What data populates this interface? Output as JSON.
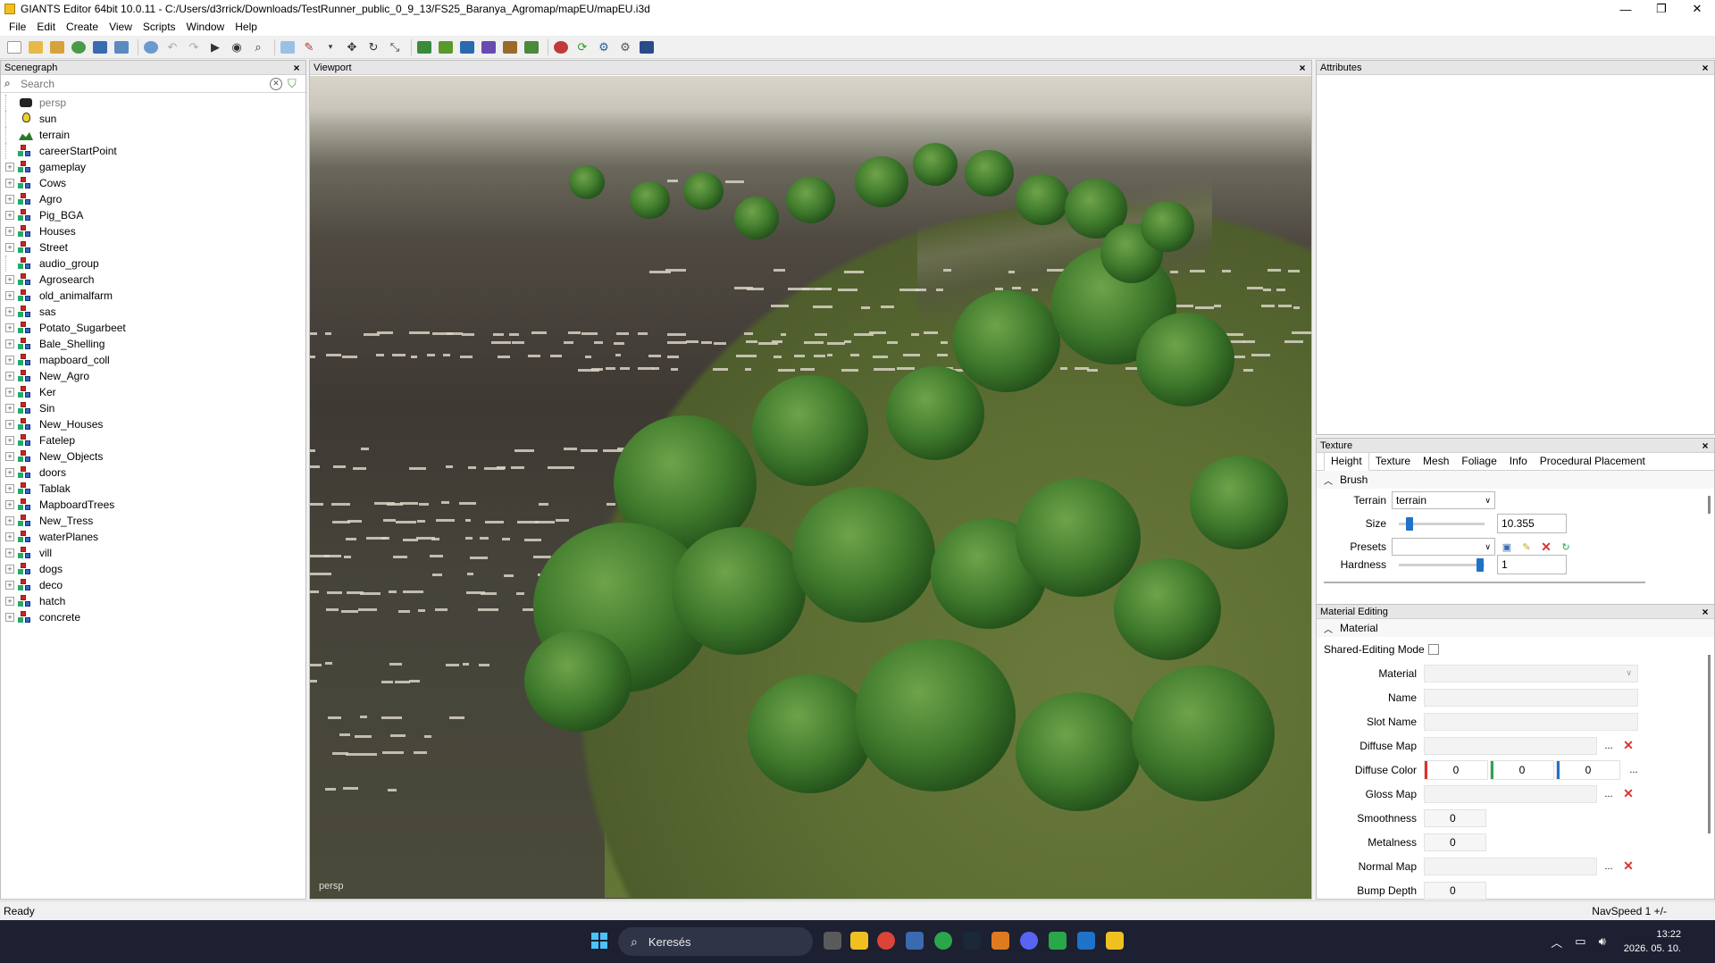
{
  "window": {
    "title": "GIANTS Editor 64bit 10.0.11 - C:/Users/d3rrick/Downloads/TestRunner_public_0_9_13/FS25_Baranya_Agromap/mapEU/mapEU.i3d",
    "minimize": "—",
    "maximize": "❐",
    "close": "✕"
  },
  "menu": [
    "File",
    "Edit",
    "Create",
    "View",
    "Scripts",
    "Window",
    "Help"
  ],
  "scenegraph": {
    "title": "Scenegraph",
    "search_placeholder": "Search",
    "nodes": [
      {
        "label": "persp",
        "icon": "camera-icon",
        "expandable": false,
        "dim": true
      },
      {
        "label": "sun",
        "icon": "light-icon",
        "expandable": false
      },
      {
        "label": "terrain",
        "icon": "terrain-icon",
        "expandable": false
      },
      {
        "label": "careerStartPoint",
        "icon": "transformgroup-icon",
        "expandable": false
      },
      {
        "label": "gameplay",
        "icon": "transformgroup-icon",
        "expandable": true
      },
      {
        "label": "Cows",
        "icon": "transformgroup-icon",
        "expandable": true
      },
      {
        "label": "Agro",
        "icon": "transformgroup-icon",
        "expandable": true
      },
      {
        "label": "Pig_BGA",
        "icon": "transformgroup-icon",
        "expandable": true
      },
      {
        "label": "Houses",
        "icon": "transformgroup-icon",
        "expandable": true
      },
      {
        "label": "Street",
        "icon": "transformgroup-icon",
        "expandable": true
      },
      {
        "label": "audio_group",
        "icon": "transformgroup-icon",
        "expandable": false
      },
      {
        "label": "Agrosearch",
        "icon": "transformgroup-icon",
        "expandable": true
      },
      {
        "label": "old_animalfarm",
        "icon": "transformgroup-icon",
        "expandable": true
      },
      {
        "label": "sas",
        "icon": "transformgroup-icon",
        "expandable": true
      },
      {
        "label": "Potato_Sugarbeet",
        "icon": "transformgroup-icon",
        "expandable": true
      },
      {
        "label": "Bale_Shelling",
        "icon": "transformgroup-icon",
        "expandable": true
      },
      {
        "label": "mapboard_coll",
        "icon": "transformgroup-icon",
        "expandable": true
      },
      {
        "label": "New_Agro",
        "icon": "transformgroup-icon",
        "expandable": true
      },
      {
        "label": "Ker",
        "icon": "transformgroup-icon",
        "expandable": true
      },
      {
        "label": "Sin",
        "icon": "transformgroup-icon",
        "expandable": true
      },
      {
        "label": "New_Houses",
        "icon": "transformgroup-icon",
        "expandable": true
      },
      {
        "label": "Fatelep",
        "icon": "transformgroup-icon",
        "expandable": true
      },
      {
        "label": "New_Objects",
        "icon": "transformgroup-icon",
        "expandable": true
      },
      {
        "label": "doors",
        "icon": "transformgroup-icon",
        "expandable": true
      },
      {
        "label": "Tablak",
        "icon": "transformgroup-icon",
        "expandable": true
      },
      {
        "label": "MapboardTrees",
        "icon": "transformgroup-icon",
        "expandable": true
      },
      {
        "label": "New_Tress",
        "icon": "transformgroup-icon",
        "expandable": true
      },
      {
        "label": "waterPlanes",
        "icon": "transformgroup-icon",
        "expandable": true
      },
      {
        "label": "vill",
        "icon": "transformgroup-icon",
        "expandable": true
      },
      {
        "label": "dogs",
        "icon": "transformgroup-icon",
        "expandable": true
      },
      {
        "label": "deco",
        "icon": "transformgroup-icon",
        "expandable": true
      },
      {
        "label": "hatch",
        "icon": "transformgroup-icon",
        "expandable": true
      },
      {
        "label": "concrete",
        "icon": "transformgroup-icon",
        "expandable": true
      }
    ]
  },
  "viewport": {
    "title": "Viewport",
    "camera_label": "persp"
  },
  "attributes": {
    "title": "Attributes"
  },
  "texture": {
    "title": "Texture",
    "tabs": [
      "Height",
      "Texture",
      "Mesh",
      "Foliage",
      "Info",
      "Procedural Placement"
    ],
    "active_tab": "Height",
    "section": "Brush",
    "terrain_label": "Terrain",
    "terrain_value": "terrain",
    "size_label": "Size",
    "size_value": "10.355",
    "size_slider_fraction": 0.12,
    "presets_label": "Presets",
    "hardness_label": "Hardness",
    "hardness_value": "1",
    "hardness_slider_fraction": 0.95
  },
  "material_editing": {
    "title": "Material Editing",
    "section": "Material",
    "shared_mode_label": "Shared-Editing Mode",
    "material_label": "Material",
    "name_label": "Name",
    "slot_name_label": "Slot Name",
    "diffuse_map_label": "Diffuse Map",
    "diffuse_color_label": "Diffuse Color",
    "diffuse_color": {
      "r": "0",
      "g": "0",
      "b": "0"
    },
    "gloss_map_label": "Gloss Map",
    "smoothness_label": "Smoothness",
    "smoothness_value": "0",
    "metalness_label": "Metalness",
    "metalness_value": "0",
    "normal_map_label": "Normal Map",
    "bump_depth_label": "Bump Depth",
    "bump_depth_value": "0",
    "browse": "..."
  },
  "status": {
    "left": "Ready",
    "right": "NavSpeed 1 +/-"
  },
  "taskbar": {
    "search": "Keresés",
    "time": "13:22",
    "date": "2026. 05. 10."
  },
  "colors": {
    "accent": "#1e73c8",
    "taskbar": "#1c2030",
    "red": "#d33333",
    "green": "#2aa64b"
  }
}
